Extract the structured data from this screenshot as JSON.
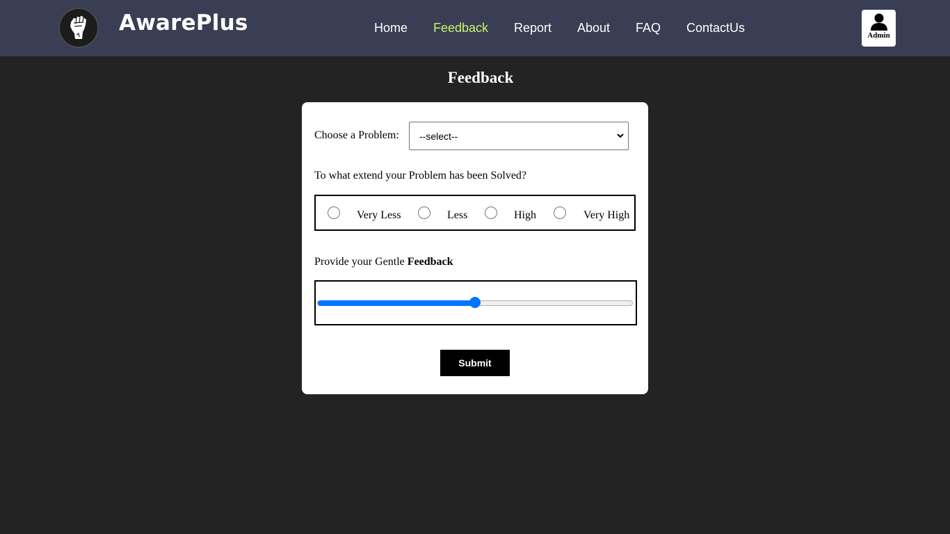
{
  "header": {
    "brand": "AwarePlus",
    "nav": [
      {
        "label": "Home",
        "active": false
      },
      {
        "label": "Feedback",
        "active": true
      },
      {
        "label": "Report",
        "active": false
      },
      {
        "label": "About",
        "active": false
      },
      {
        "label": "FAQ",
        "active": false
      },
      {
        "label": "ContactUs",
        "active": false
      }
    ],
    "admin_label": "Admin",
    "active_color": "#c6f56b",
    "logo_icon": "raised-fist-icon",
    "admin_icon": "user-icon"
  },
  "page": {
    "title": "Feedback"
  },
  "form": {
    "problem_label": "Choose a Problem:",
    "problem_select_value": "--select--",
    "solved_question": "To what extend your Problem has been Solved?",
    "solved_options": [
      "Very Less",
      "Less",
      "High",
      "Very High"
    ],
    "solved_selected": null,
    "feedback_prefix": "Provide your Gentle",
    "feedback_bold": "Feedback",
    "feedback_slider_value": 0.5,
    "submit_label": "Submit",
    "accent_color": "#0075ff"
  }
}
